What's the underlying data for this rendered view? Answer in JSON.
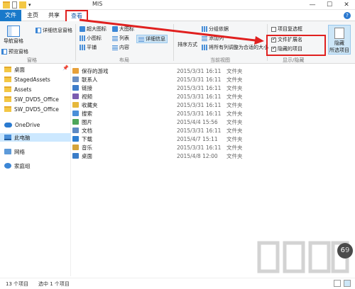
{
  "window": {
    "title": "MIS",
    "minimize": "—",
    "maximize": "☐",
    "close": "✕"
  },
  "menu": {
    "file": "文件",
    "home": "主页",
    "share": "共享",
    "view": "查看"
  },
  "ribbon": {
    "nav_pane": "导航窗格",
    "preview_pane": "预览窗格",
    "details_pane": "详细信息窗格",
    "group_panes": "窗格",
    "extra_large_icons": "超大图标",
    "large_icons": "大图标",
    "small_icons": "小图标",
    "list": "列表",
    "tiles": "平铺",
    "content": "内容",
    "details": "详细信息",
    "group_layout": "布局",
    "sort_by": "排序方式",
    "group_by": "分组依据",
    "add_columns": "添加列",
    "size_all_columns": "将所有列调整为合适的大小",
    "group_current_view": "当前视图",
    "item_check_boxes": "项目复选框",
    "file_name_extensions": "文件扩展名",
    "hidden_items": "隐藏的项目",
    "hide_selected": "隐藏",
    "hide_selected_2": "所选项目",
    "group_show_hide": "显示/隐藏"
  },
  "nav": {
    "items": [
      {
        "label": "桌面",
        "type": "folder"
      },
      {
        "label": "StagedAssets",
        "type": "folder"
      },
      {
        "label": "Assets",
        "type": "folder"
      },
      {
        "label": "SW_DVD5_Office",
        "type": "folder"
      },
      {
        "label": "SW_DVD5_Office",
        "type": "folder"
      },
      {
        "label": "OneDrive",
        "type": "cloud"
      },
      {
        "label": "此电脑",
        "type": "pc"
      },
      {
        "label": "网络",
        "type": "net"
      },
      {
        "label": "家庭组",
        "type": "home"
      }
    ]
  },
  "files": [
    {
      "name": "保存的游戏",
      "date": "2015/3/31 16:11",
      "type": "文件夹",
      "color": "#e8a13a"
    },
    {
      "name": "联系人",
      "date": "2015/3/31 16:11",
      "type": "文件夹",
      "color": "#6b8fc4"
    },
    {
      "name": "链接",
      "date": "2015/3/31 16:11",
      "type": "文件夹",
      "color": "#3d7cc9"
    },
    {
      "name": "视频",
      "date": "2015/3/31 16:11",
      "type": "文件夹",
      "color": "#7a5cb0"
    },
    {
      "name": "收藏夹",
      "date": "2015/3/31 16:11",
      "type": "文件夹",
      "color": "#e6b83b"
    },
    {
      "name": "搜索",
      "date": "2015/3/31 16:11",
      "type": "文件夹",
      "color": "#4a8fd8"
    },
    {
      "name": "图片",
      "date": "2015/4/4 15:56",
      "type": "文件夹",
      "color": "#4da55a"
    },
    {
      "name": "文档",
      "date": "2015/3/31 16:11",
      "type": "文件夹",
      "color": "#5e8ac4"
    },
    {
      "name": "下载",
      "date": "2015/4/7 15:11",
      "type": "文件夹",
      "color": "#2f7fd1"
    },
    {
      "name": "音乐",
      "date": "2015/3/31 16:11",
      "type": "文件夹",
      "color": "#d5a43a"
    },
    {
      "name": "桌面",
      "date": "2015/4/8 12:00",
      "type": "文件夹",
      "color": "#3a7dc8"
    }
  ],
  "status": {
    "count": "13 个项目",
    "selected": "选中 1 个项目"
  },
  "watermark": {
    "badge": "69"
  },
  "colors": {
    "accent": "#1979ca",
    "highlight": "#e0201f"
  }
}
